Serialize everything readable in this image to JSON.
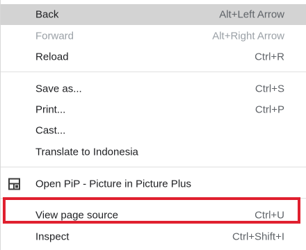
{
  "menu": {
    "items": [
      {
        "label": "Back",
        "shortcut": "Alt+Left Arrow"
      },
      {
        "label": "Forward",
        "shortcut": "Alt+Right Arrow"
      },
      {
        "label": "Reload",
        "shortcut": "Ctrl+R"
      },
      {
        "label": "Save as...",
        "shortcut": "Ctrl+S"
      },
      {
        "label": "Print...",
        "shortcut": "Ctrl+P"
      },
      {
        "label": "Cast...",
        "shortcut": ""
      },
      {
        "label": "Translate to Indonesia",
        "shortcut": ""
      },
      {
        "label": "Open PiP - Picture in Picture Plus",
        "shortcut": "",
        "icon": "pip-extension-icon"
      },
      {
        "label": "View page source",
        "shortcut": "Ctrl+U"
      },
      {
        "label": "Inspect",
        "shortcut": "Ctrl+Shift+I"
      }
    ],
    "states": {
      "hovered_item": "Back",
      "disabled_item": "Forward",
      "highlighted_item": "View page source"
    }
  },
  "colors": {
    "hover_background": "#d3d3d3",
    "highlight_border": "#e0202f",
    "disabled_text": "#9aa0a6"
  }
}
